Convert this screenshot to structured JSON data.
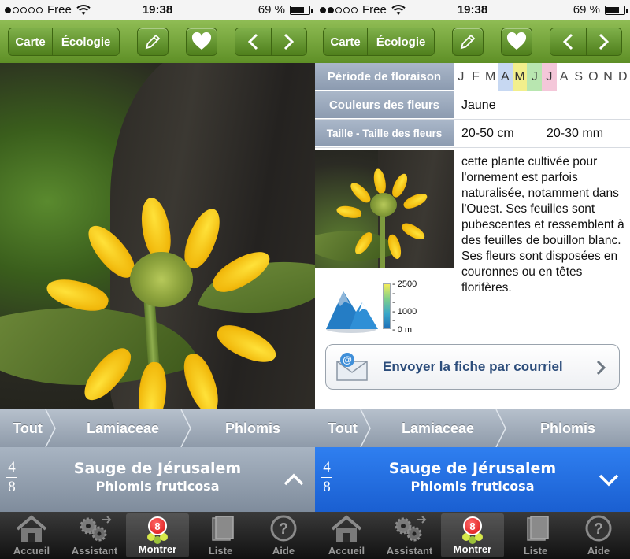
{
  "status": {
    "carrier": "Free",
    "time": "19:38",
    "battery": "69 %",
    "battery_level": 0.69
  },
  "toolbar": {
    "map_label": "Carte",
    "ecology_label": "Écologie"
  },
  "scale": {
    "unit": "cm"
  },
  "breadcrumb": {
    "items": [
      "Tout",
      "Lamiaceae",
      "Phlomis"
    ]
  },
  "species": {
    "index": "4",
    "total": "8",
    "common_name": "Sauge de Jérusalem",
    "latin_name": "Phlomis fruticosa"
  },
  "tabs": {
    "items": [
      "Accueil",
      "Assistant",
      "Montrer",
      "Liste",
      "Aide"
    ],
    "badge": "8",
    "active_index": 2
  },
  "details": {
    "flowering_label": "Période de floraison",
    "months": [
      "J",
      "F",
      "M",
      "A",
      "M",
      "J",
      "J",
      "A",
      "S",
      "O",
      "N",
      "D"
    ],
    "flowering_months_active": [
      3,
      4,
      5,
      6
    ],
    "colors_label": "Couleurs des fleurs",
    "colors_value": "Jaune",
    "size_label": "Taille - Taille des fleurs",
    "plant_size": "20-50 cm",
    "flower_size": "20-30 mm",
    "description": "cette plante cultivée pour l'ornement est parfois naturalisée, notamment dans l'Ouest. Ses feuilles sont pubescentes et ressemblent à des feuilles de bouillon blanc. Ses fleurs sont disposées en couronnes ou en têtes florifères.",
    "altitude_labels": [
      "- 2500",
      "-",
      "-",
      "- 1000",
      "-",
      "- 0 m"
    ],
    "email_button": "Envoyer la fiche par courriel"
  },
  "colors": {
    "green_bar": "#6f9f35",
    "blue_selected": "#2a74e8",
    "grey_bar": "#95a1b0"
  }
}
